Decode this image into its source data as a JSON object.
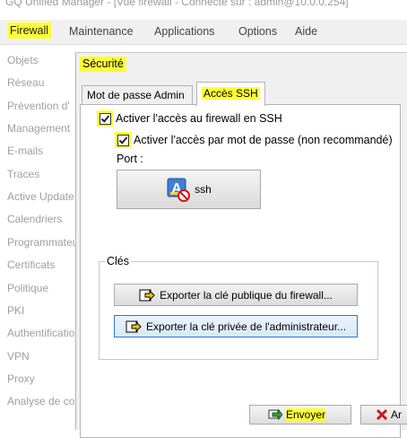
{
  "window": {
    "title": "GQ Unified Manager - [Vue firewall - Connecté sur : admin@10.0.0.254]"
  },
  "menubar": {
    "items": [
      "Firewall",
      "Maintenance",
      "Applications",
      "Options",
      "Aide"
    ]
  },
  "sidebar": {
    "items": [
      "Objets",
      "Réseau",
      "Prévention d'",
      "Management",
      "E-mails",
      "Traces",
      "Active Update",
      "Calendriers",
      "Programmateu",
      "Certificats",
      "Politique",
      "PKI",
      "Authentificatio",
      "VPN",
      "Proxy",
      "Analyse de co"
    ]
  },
  "dialog": {
    "title": "Sécurité",
    "tabs": [
      "Mot de passe Admin",
      "Accès SSH"
    ],
    "active_tab": "Accès SSH",
    "ssh_enable": {
      "label": "Activer l'accès au firewall en SSH",
      "checked": true
    },
    "password_enable": {
      "label": "Activer l'accès par mot de passe (non recommandé)",
      "checked": true
    },
    "port": {
      "label": "Port :",
      "value": "ssh"
    },
    "keys": {
      "legend": "Clés",
      "export_public": "Exporter la clé publique du firewall...",
      "export_private": "Exporter la clé privée de l'administrateur..."
    },
    "buttons": {
      "send": "Envoyer",
      "cancel": "Ar"
    }
  },
  "colors": {
    "highlight": "#ffff38",
    "focus_border": "#2b76d2",
    "cancel_icon": "#d01818"
  }
}
